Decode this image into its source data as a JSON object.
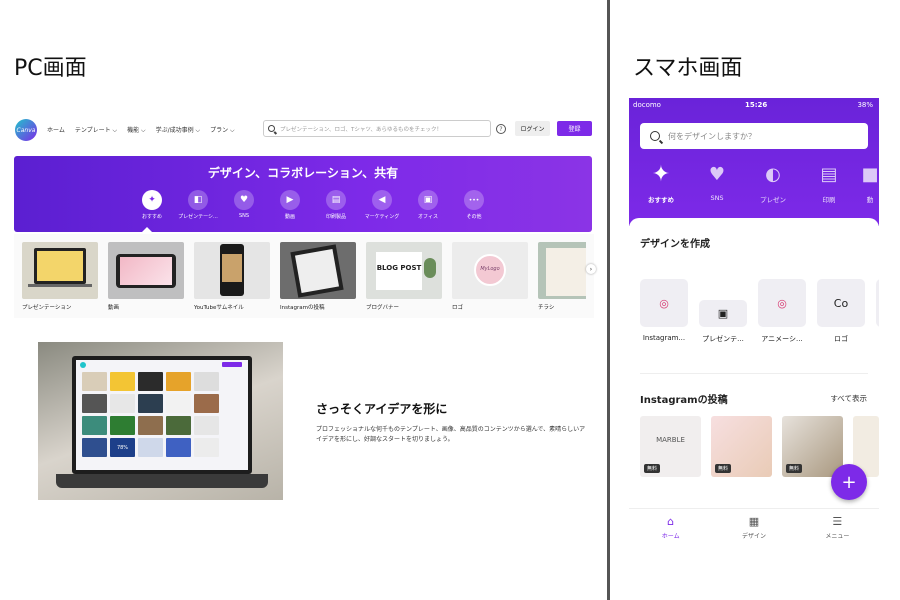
{
  "labels": {
    "pc": "PC画面",
    "sp": "スマホ画面"
  },
  "colors": {
    "brand": "#7d2ae8",
    "teal": "#20c4cb"
  },
  "pc": {
    "logo": "Canva",
    "menu": [
      "ホーム",
      "テンプレート ⌵",
      "機能 ⌵",
      "学ぶ/成功事例 ⌵",
      "プラン ⌵"
    ],
    "search_placeholder": "プレゼンテーション、ロゴ、Tシャツ、あらゆるものをチェック！",
    "help": "?",
    "login": "ログイン",
    "register": "登録",
    "hero_title": "デザイン、コラボレーション、共有",
    "categories": [
      {
        "label": "おすすめ",
        "icon": "sparkle-icon",
        "glyph": "✦"
      },
      {
        "label": "プレゼンテーシ...",
        "icon": "presentation-icon",
        "glyph": "◧"
      },
      {
        "label": "SNS",
        "icon": "heart-chat-icon",
        "glyph": "♥"
      },
      {
        "label": "動画",
        "icon": "video-icon",
        "glyph": "▶"
      },
      {
        "label": "印刷製品",
        "icon": "print-icon",
        "glyph": "▤"
      },
      {
        "label": "マーケティング",
        "icon": "megaphone-icon",
        "glyph": "◀"
      },
      {
        "label": "オフィス",
        "icon": "briefcase-icon",
        "glyph": "▣"
      },
      {
        "label": "その他",
        "icon": "more-icon",
        "glyph": "•••"
      }
    ],
    "templates": [
      "プレゼンテーション",
      "動画",
      "YouTubeサムネイル",
      "Instagramの投稿",
      "ブログバナー",
      "ロゴ",
      "チラシ"
    ],
    "blog_post_text": "BLOG POST",
    "logo_sample_text": "MyLogo",
    "promo_title": "さっそくアイデアを形に",
    "promo_text": "プロフェッショナルな何千ものテンプレート、画像、高品質のコンテンツから選んで、素晴らしいアイデアを形にし、好調なスタートを切りましょう。",
    "laptop_stat": "78%"
  },
  "sp": {
    "status": {
      "carrier": "docomo",
      "time": "15:26",
      "battery": "38%"
    },
    "search_placeholder": "何をデザインしますか？",
    "categories": [
      {
        "label": "おすすめ",
        "icon": "sparkle-icon",
        "glyph": "✦"
      },
      {
        "label": "SNS",
        "icon": "heart-chat-icon",
        "glyph": "♥"
      },
      {
        "label": "プレゼン",
        "icon": "presentation-icon",
        "glyph": "◐"
      },
      {
        "label": "印刷",
        "icon": "print-icon",
        "glyph": "▤"
      },
      {
        "label": "動",
        "icon": "video-icon",
        "glyph": "■"
      }
    ],
    "create_title": "デザインを作成",
    "create_items": [
      {
        "label": "Instagram...",
        "icon": "instagram-icon",
        "glyph": "◎"
      },
      {
        "label": "プレゼンテ...",
        "icon": "presentation-icon",
        "glyph": "▣"
      },
      {
        "label": "アニメーシ...",
        "icon": "instagram-icon",
        "glyph": "◎"
      },
      {
        "label": "ロゴ",
        "icon": "logo-co-icon",
        "glyph": "Co"
      }
    ],
    "insta_title": "Instagramの投稿",
    "see_all": "すべて表示",
    "free_badge": "無料",
    "post_text": "MARBLE",
    "fab": "+",
    "tabs": [
      {
        "label": "ホーム",
        "icon": "home-icon",
        "glyph": "⌂"
      },
      {
        "label": "デザイン",
        "icon": "grid-icon",
        "glyph": "▦"
      },
      {
        "label": "メニュー",
        "icon": "menu-icon",
        "glyph": "☰"
      }
    ]
  }
}
